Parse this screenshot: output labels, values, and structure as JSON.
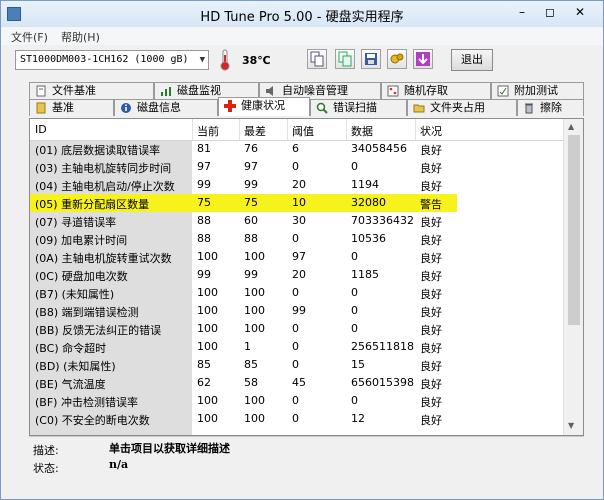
{
  "window": {
    "title": "HD Tune Pro 5.00 - 硬盘实用程序"
  },
  "menu": [
    "文件(F)",
    "帮助(H)"
  ],
  "toolbar": {
    "drive": "ST1000DM003-1CH162 (1000 gB)",
    "temperature": "38℃",
    "exit_label": "退出"
  },
  "tabs_row1": [
    "文件基准",
    "磁盘监视",
    "自动噪音管理",
    "随机存取",
    "附加测试"
  ],
  "tabs_row2": [
    "基准",
    "磁盘信息",
    "健康状况",
    "错误扫描",
    "文件夹占用",
    "擦除"
  ],
  "active_tab": "健康状况",
  "columns": [
    "ID",
    "当前",
    "最差",
    "阈值",
    "数据",
    "状况"
  ],
  "rows": [
    {
      "id": "(01) 底层数据读取错误率",
      "cur": "81",
      "worst": "76",
      "thr": "6",
      "data": "34058456",
      "status": "良好"
    },
    {
      "id": "(03) 主轴电机旋转同步时间",
      "cur": "97",
      "worst": "97",
      "thr": "0",
      "data": "0",
      "status": "良好"
    },
    {
      "id": "(04) 主轴电机启动/停止次数",
      "cur": "99",
      "worst": "99",
      "thr": "20",
      "data": "1194",
      "status": "良好"
    },
    {
      "id": "(05) 重新分配扇区数量",
      "cur": "75",
      "worst": "75",
      "thr": "10",
      "data": "32080",
      "status": "警告",
      "highlight": true
    },
    {
      "id": "(07) 寻道错误率",
      "cur": "88",
      "worst": "60",
      "thr": "30",
      "data": "703336432",
      "status": "良好"
    },
    {
      "id": "(09) 加电累计时间",
      "cur": "88",
      "worst": "88",
      "thr": "0",
      "data": "10536",
      "status": "良好"
    },
    {
      "id": "(0A) 主轴电机旋转重试次数",
      "cur": "100",
      "worst": "100",
      "thr": "97",
      "data": "0",
      "status": "良好"
    },
    {
      "id": "(0C) 硬盘加电次数",
      "cur": "99",
      "worst": "99",
      "thr": "20",
      "data": "1185",
      "status": "良好"
    },
    {
      "id": "(B7) (未知属性)",
      "cur": "100",
      "worst": "100",
      "thr": "0",
      "data": "0",
      "status": "良好"
    },
    {
      "id": "(B8) 端到端错误检测",
      "cur": "100",
      "worst": "100",
      "thr": "99",
      "data": "0",
      "status": "良好"
    },
    {
      "id": "(BB) 反馈无法纠正的错误",
      "cur": "100",
      "worst": "100",
      "thr": "0",
      "data": "0",
      "status": "良好"
    },
    {
      "id": "(BC) 命令超时",
      "cur": "100",
      "worst": "1",
      "thr": "0",
      "data": "256511818",
      "status": "良好"
    },
    {
      "id": "(BD) (未知属性)",
      "cur": "85",
      "worst": "85",
      "thr": "0",
      "data": "15",
      "status": "良好"
    },
    {
      "id": "(BE) 气流温度",
      "cur": "62",
      "worst": "58",
      "thr": "45",
      "data": "656015398",
      "status": "良好"
    },
    {
      "id": "(BF) 冲击检测错误率",
      "cur": "100",
      "worst": "100",
      "thr": "0",
      "data": "0",
      "status": "良好"
    },
    {
      "id": "(C0) 不安全的断电次数",
      "cur": "100",
      "worst": "100",
      "thr": "0",
      "data": "12",
      "status": "良好"
    },
    {
      "id": "",
      "cur": "",
      "worst": "",
      "thr": "",
      "data": "",
      "status": ""
    }
  ],
  "details": {
    "desc_label": "描述:",
    "desc_value": "单击项目以获取详细描述",
    "status_label": "状态:",
    "status_value": "n/a"
  },
  "colors": {
    "highlight": "#f7f21c",
    "accent": "#4a7fb9"
  }
}
